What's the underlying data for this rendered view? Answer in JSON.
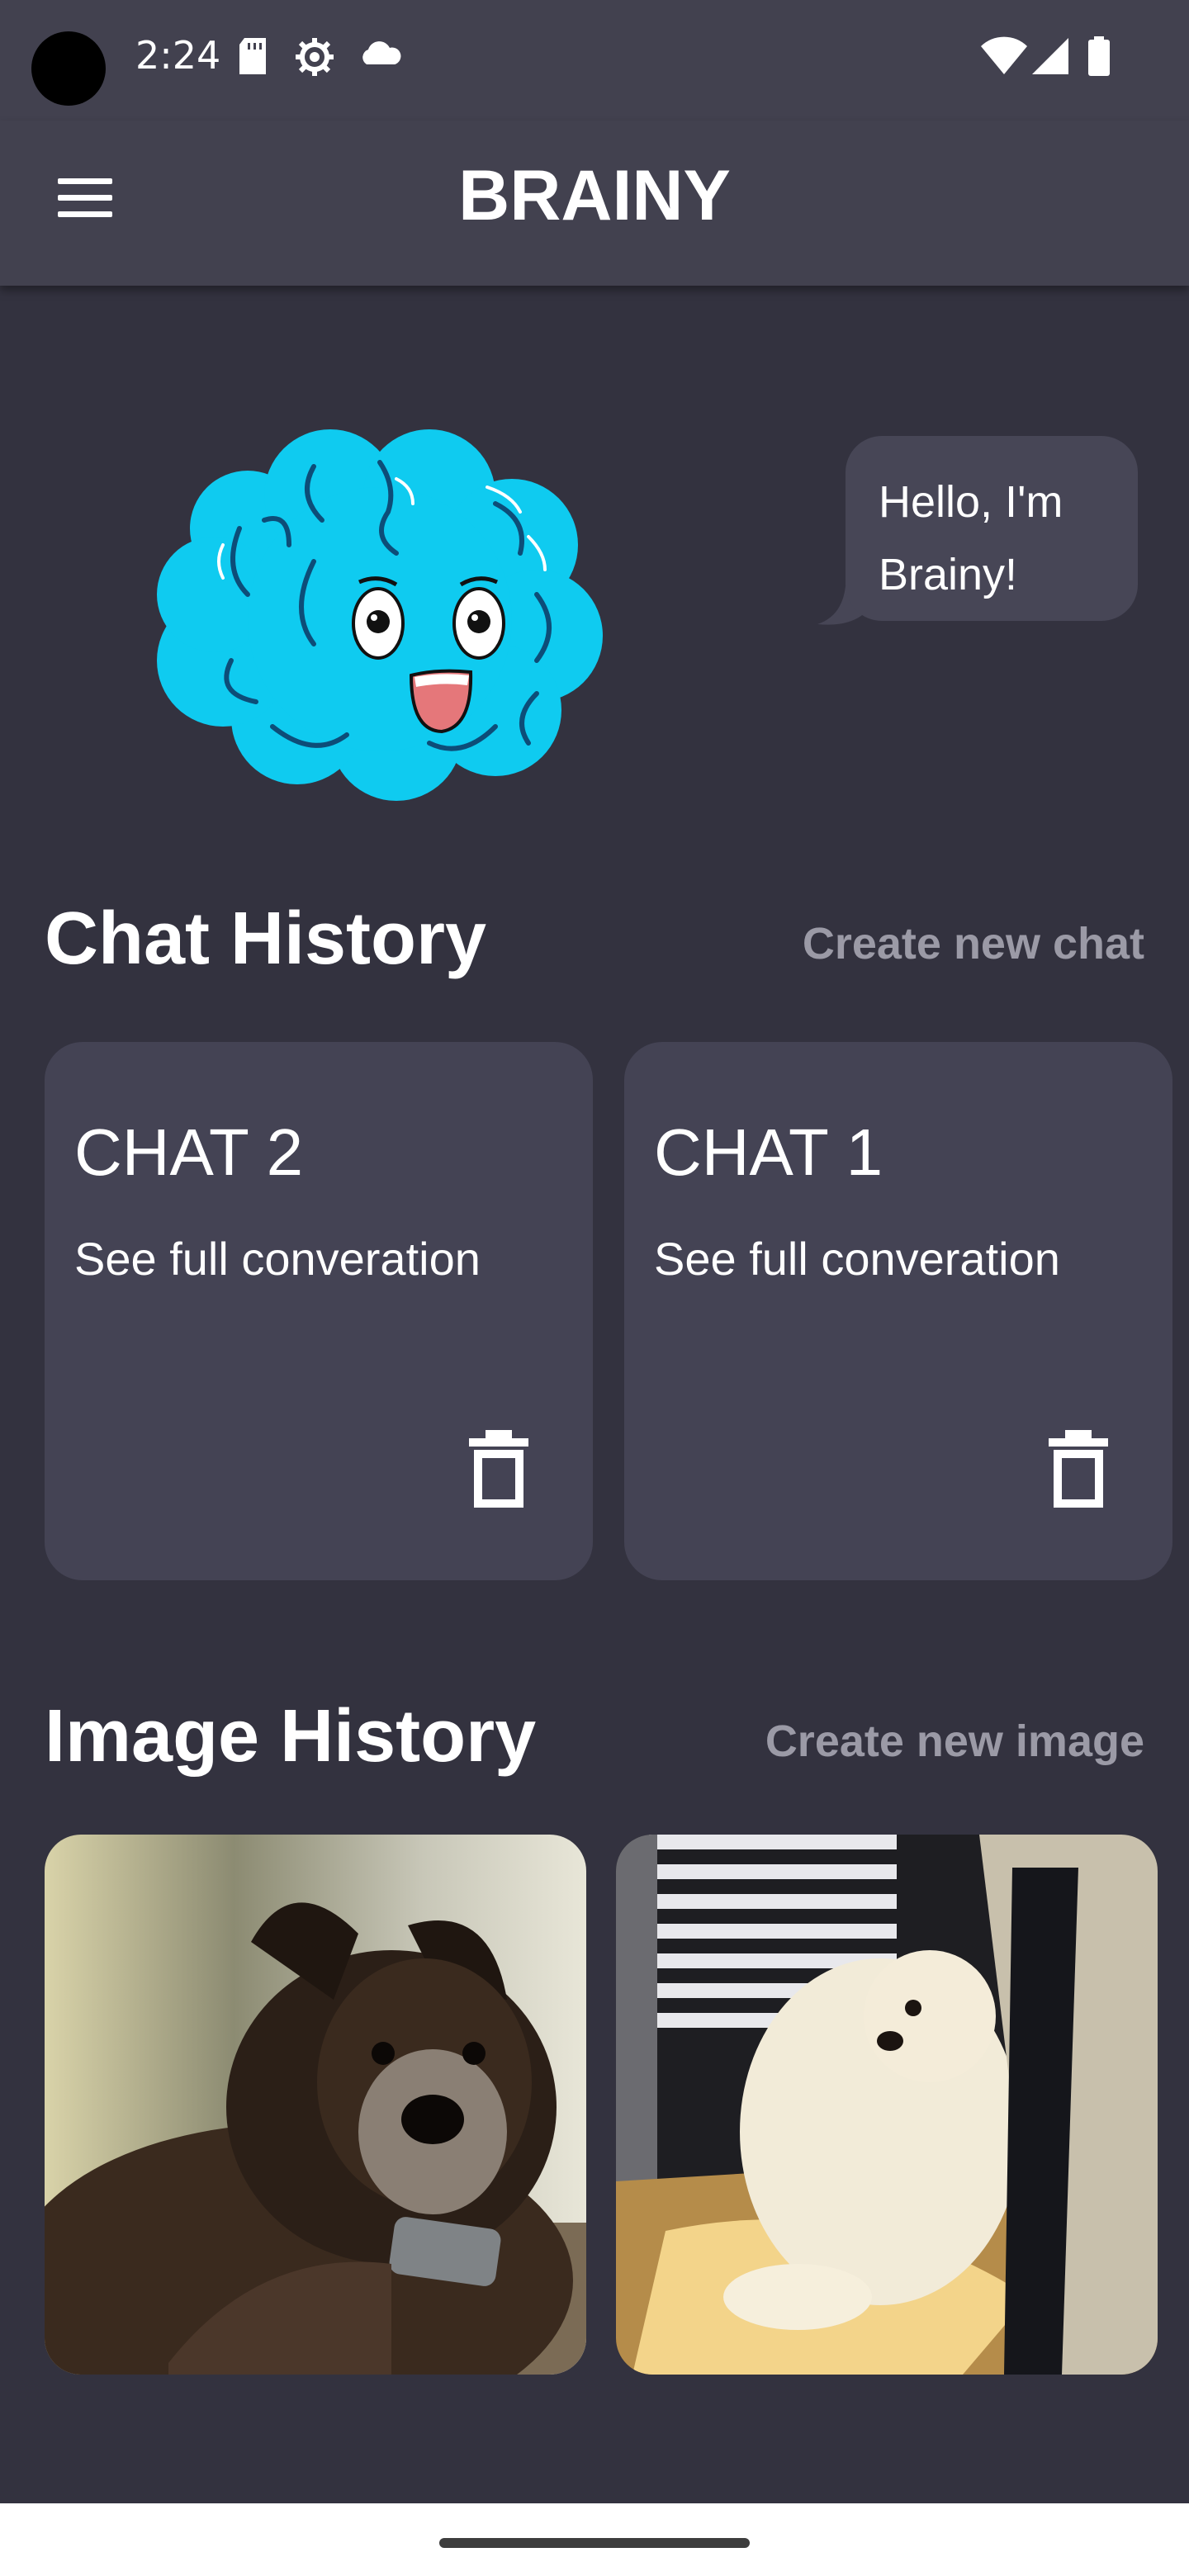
{
  "status_bar": {
    "time": "2:24",
    "left_icons": [
      "sd-card-icon",
      "settings-icon",
      "cloud-icon"
    ],
    "right_icons": [
      "wifi-icon",
      "signal-icon",
      "battery-icon"
    ]
  },
  "app_bar": {
    "title": "BRAINY",
    "menu_icon": "menu-icon"
  },
  "hero": {
    "mascot": "brain-mascot",
    "greeting": "Hello, I'm Brainy!"
  },
  "chat_history": {
    "title": "Chat History",
    "action": "Create new chat",
    "items": [
      {
        "title": "CHAT 2",
        "subtitle": "See full converation",
        "icon": "trash-icon"
      },
      {
        "title": "CHAT 1",
        "subtitle": "See full converation",
        "icon": "trash-icon"
      }
    ]
  },
  "image_history": {
    "title": "Image History",
    "action": "Create new image",
    "items": [
      {
        "subject": "dark-dog-photo"
      },
      {
        "subject": "white-dog-photo"
      }
    ]
  },
  "colors": {
    "background": "#33323f",
    "app_bar": "#42414f",
    "card": "#444354",
    "link": "#9b9aa6",
    "brain": "#0fcbf0"
  }
}
